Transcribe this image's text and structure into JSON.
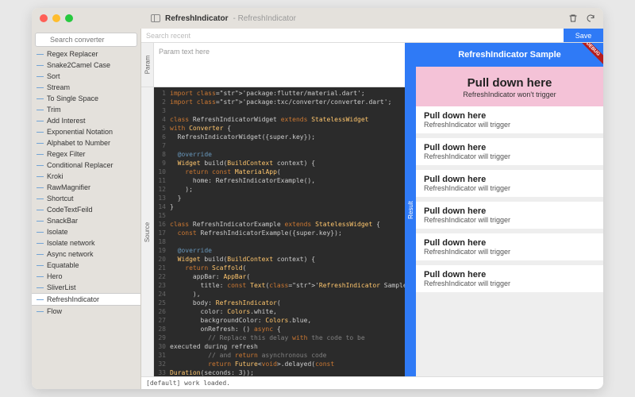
{
  "window": {
    "title": "RefreshIndicator",
    "subtitle": "- RefreshIndicator"
  },
  "sidebar": {
    "search_placeholder": "Search converter",
    "items": [
      {
        "label": "Regex Replacer"
      },
      {
        "label": "Snake2Camel Case"
      },
      {
        "label": "Sort"
      },
      {
        "label": "Stream"
      },
      {
        "label": "To Single Space"
      },
      {
        "label": "Trim"
      },
      {
        "label": "Add Interest"
      },
      {
        "label": "Exponential Notation"
      },
      {
        "label": "Alphabet to Number"
      },
      {
        "label": "Regex Filter"
      },
      {
        "label": "Conditional Replacer"
      },
      {
        "label": "Kroki"
      },
      {
        "label": "RawMagnifier"
      },
      {
        "label": "Shortcut"
      },
      {
        "label": "CodeTextFeild"
      },
      {
        "label": "SnackBar"
      },
      {
        "label": "Isolate"
      },
      {
        "label": "Isolate network"
      },
      {
        "label": "Async network"
      },
      {
        "label": "Equatable"
      },
      {
        "label": "Hero"
      },
      {
        "label": "SliverList"
      },
      {
        "label": "RefreshIndicator",
        "selected": true
      },
      {
        "label": "Flow"
      }
    ]
  },
  "toolbar": {
    "search_placeholder": "Search recent",
    "save_label": "Save"
  },
  "panels": {
    "param_label": "Param",
    "param_text": "Param text here",
    "source_label": "Source",
    "result_label": "Result"
  },
  "code_lines": [
    "import 'package:flutter/material.dart';",
    "import 'package:txc/converter/converter.dart';",
    "",
    "class RefreshIndicatorWidget extends StatelessWidget",
    "with Converter {",
    "  RefreshIndicatorWidget({super.key});",
    "",
    "  @override",
    "  Widget build(BuildContext context) {",
    "    return const MaterialApp(",
    "      home: RefreshIndicatorExample(),",
    "    );",
    "  }",
    "}",
    "",
    "class RefreshIndicatorExample extends StatelessWidget {",
    "  const RefreshIndicatorExample({super.key});",
    "",
    "  @override",
    "  Widget build(BuildContext context) {",
    "    return Scaffold(",
    "      appBar: AppBar(",
    "        title: const Text('RefreshIndicator Sample'),",
    "      ),",
    "      body: RefreshIndicator(",
    "        color: Colors.white,",
    "        backgroundColor: Colors.blue,",
    "        onRefresh: () async {",
    "          // Replace this delay with the code to be",
    "executed during refresh",
    "          // and return asynchronous code",
    "          return Future<void>.delayed(const",
    "Duration(seconds: 3));"
  ],
  "preview": {
    "appbar_title": "RefreshIndicator Sample",
    "debug_label": "DEBUG",
    "pink_title": "Pull down here",
    "pink_sub": "RefreshIndicator won't trigger",
    "rows": [
      {
        "title": "Pull down here",
        "sub": "RefreshIndicator will trigger"
      },
      {
        "title": "Pull down here",
        "sub": "RefreshIndicator will trigger"
      },
      {
        "title": "Pull down here",
        "sub": "RefreshIndicator will trigger"
      },
      {
        "title": "Pull down here",
        "sub": "RefreshIndicator will trigger"
      },
      {
        "title": "Pull down here",
        "sub": "RefreshIndicator will trigger"
      },
      {
        "title": "Pull down here",
        "sub": "RefreshIndicator will trigger"
      }
    ]
  },
  "status": "[default] work loaded."
}
